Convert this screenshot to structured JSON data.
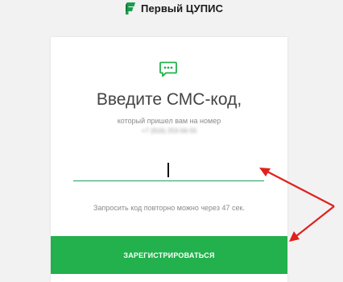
{
  "brand": {
    "name": "Первый ЦУПИС"
  },
  "verify": {
    "heading": "Введите СМС-код,",
    "subtext": "который пришел вам на номер",
    "phone": "+7 (916) 253-56-55",
    "code_value": "",
    "resend_text": "Запросить код повторно можно через 47 сек.",
    "register_label": "ЗАРЕГИСТРИРОВАТЬСЯ"
  },
  "colors": {
    "accent": "#22b14c",
    "input_underline": "#1f9f5c",
    "annotation_arrow": "#e0201b",
    "background": "#f2f2f2"
  },
  "icons": {
    "brand": "cupis-logo-icon",
    "sms": "sms-chat-icon"
  }
}
